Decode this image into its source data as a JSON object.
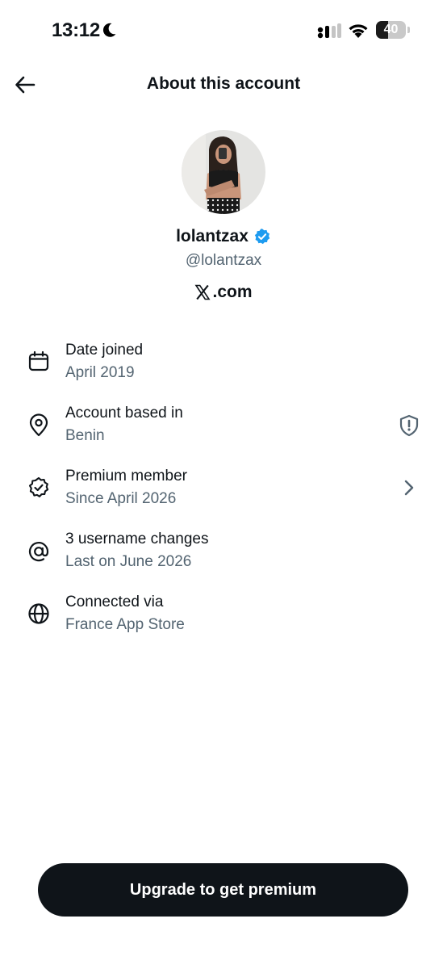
{
  "status_bar": {
    "time": "13:12",
    "battery_level": "40",
    "battery_fraction": 0.4
  },
  "header": {
    "title": "About this account"
  },
  "profile": {
    "display_name": "lolantzax",
    "handle": "@lolantzax",
    "verified": true,
    "verified_color": "#1d9bf0",
    "site": ".com"
  },
  "info_items": [
    {
      "icon": "calendar-icon",
      "title": "Date joined",
      "subtitle": "April 2019"
    },
    {
      "icon": "location-pin-icon",
      "title": "Account based in",
      "subtitle": "Benin",
      "trailing_icon": "shield-alert-icon"
    },
    {
      "icon": "verified-badge-outline-icon",
      "title": "Premium member",
      "subtitle": "Since April 2026",
      "trailing_icon": "chevron-right-icon"
    },
    {
      "icon": "at-sign-icon",
      "title": "3 username changes",
      "subtitle": "Last on June 2026"
    },
    {
      "icon": "globe-icon",
      "title": "Connected via",
      "subtitle": "France App Store"
    }
  ],
  "upgrade_button": {
    "label": "Upgrade to get premium"
  },
  "colors": {
    "text_primary": "#0f1419",
    "text_secondary": "#536471",
    "button_bg": "#0f1419",
    "background": "#ffffff"
  }
}
